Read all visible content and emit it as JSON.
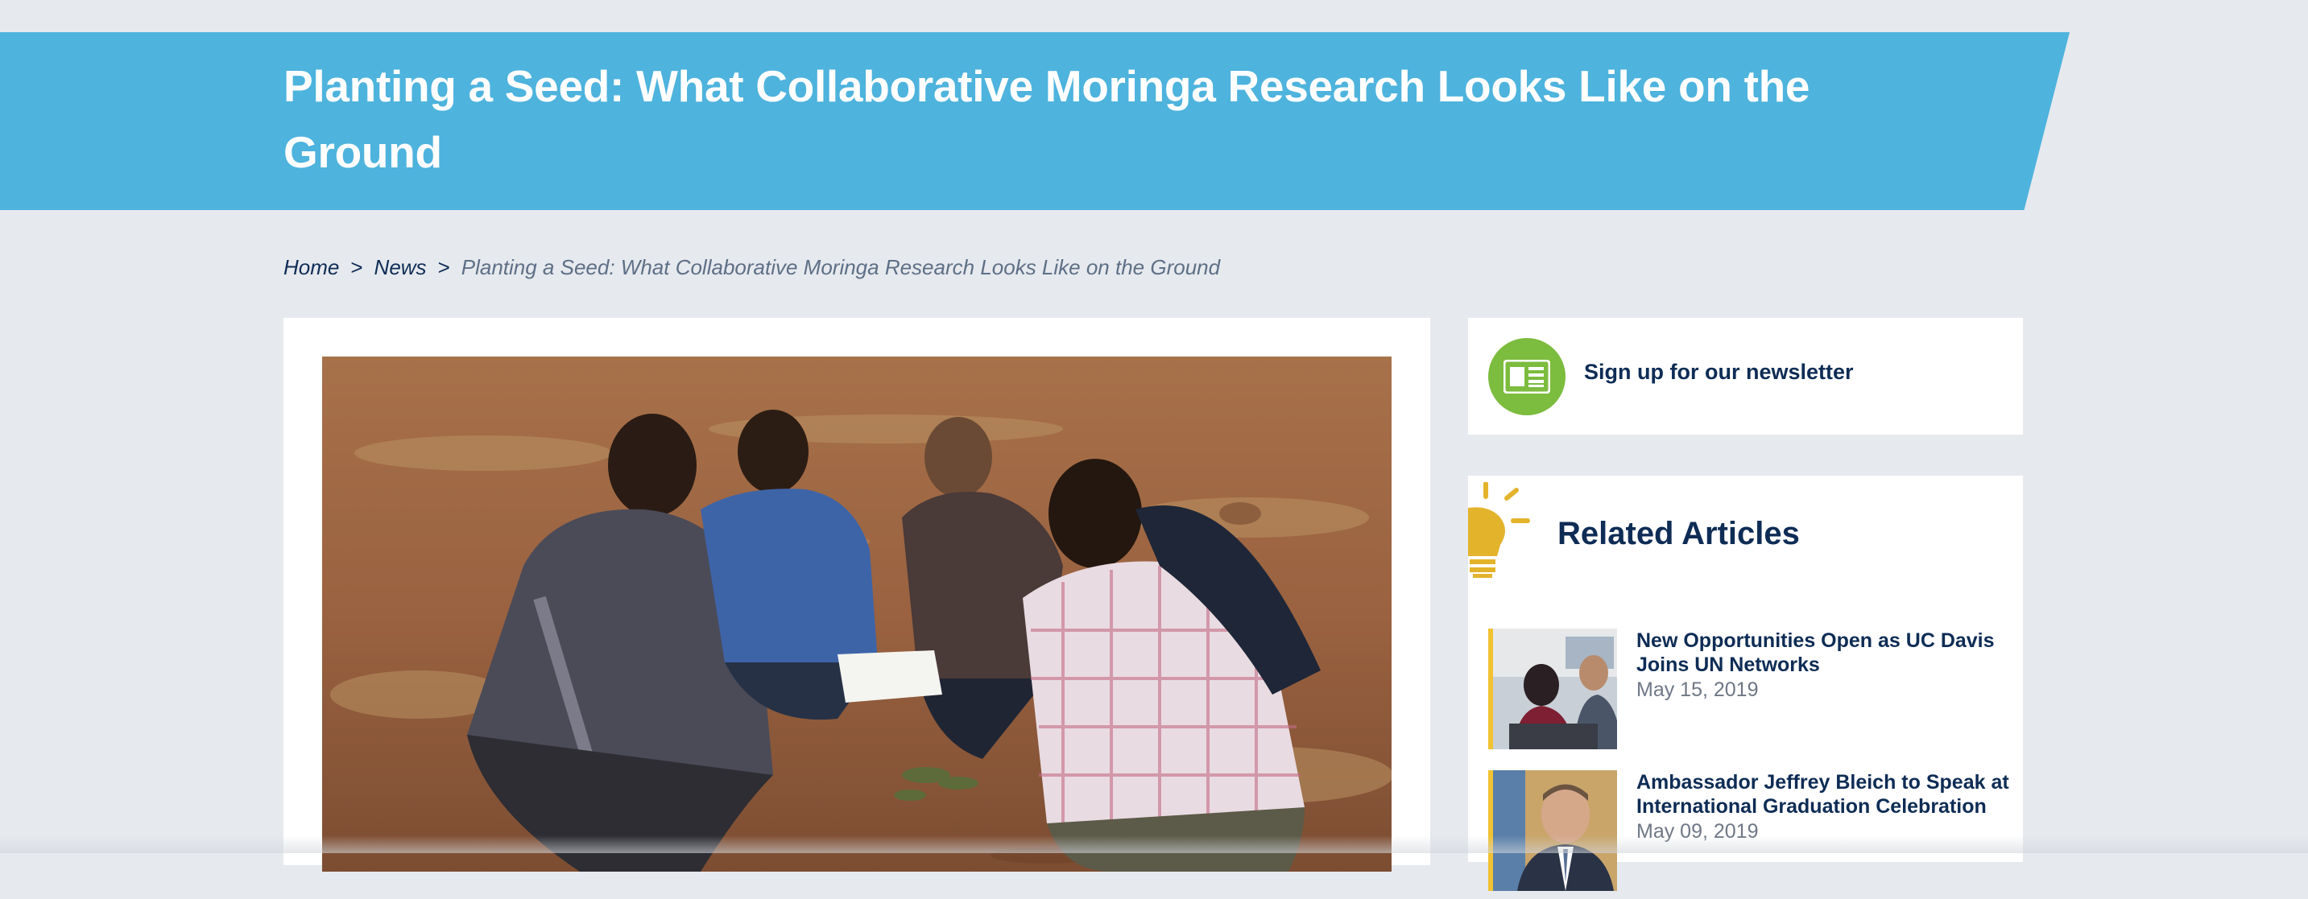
{
  "header": {
    "title": "Planting a Seed: What Collaborative Moringa Research Looks Like on the Ground"
  },
  "breadcrumb": {
    "home": "Home",
    "separator": ">",
    "news": "News",
    "current": "Planting a Seed: What Collaborative Moringa Research Looks Like on the Ground"
  },
  "hero_image": {
    "icon": "photo-researchers-in-field"
  },
  "newsletter": {
    "label": "Sign up for our newsletter",
    "icon": "newspaper-icon",
    "icon_color": "#7cbc3e"
  },
  "related": {
    "title": "Related Articles",
    "icon": "lightbulb-icon",
    "icon_color": "#e3b32b",
    "articles": [
      {
        "title": "New Opportunities Open as UC Davis Joins UN Networks",
        "date": "May 15, 2019"
      },
      {
        "title": "Ambassador Jeffrey Bleich to Speak at International Graduation Celebration",
        "date": "May 09, 2019"
      }
    ]
  },
  "colors": {
    "banner": "#4eb3dd",
    "navy": "#0e2c55",
    "page_bg": "#e6e9ee"
  }
}
